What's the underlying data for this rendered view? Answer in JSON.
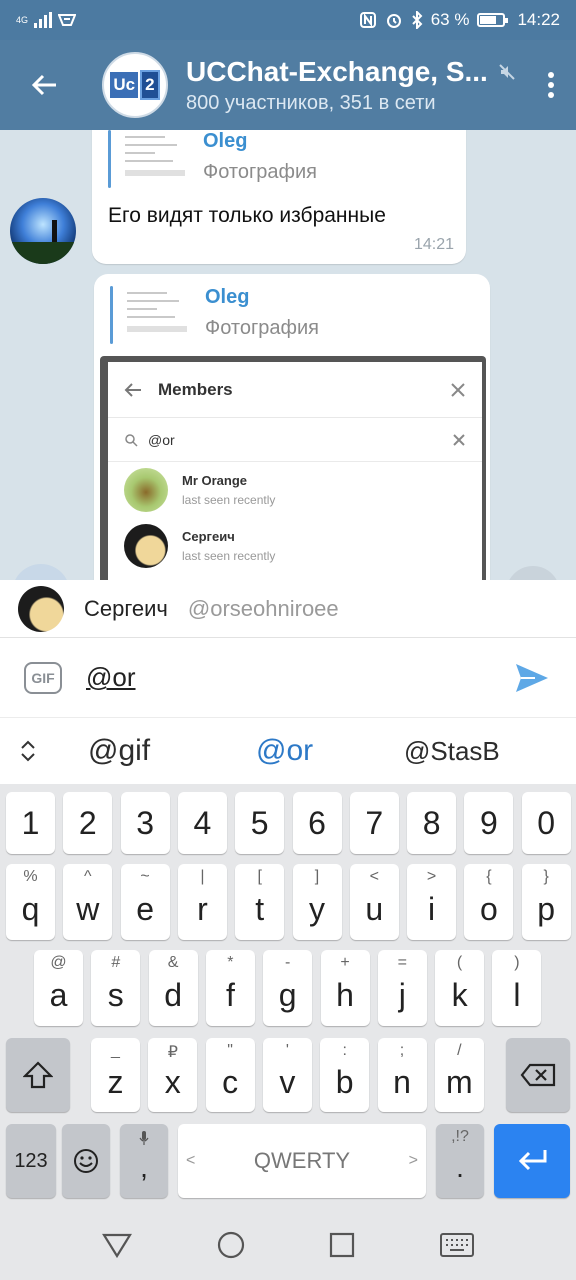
{
  "status_bar": {
    "network": "4G",
    "battery": "63 %",
    "time": "14:22"
  },
  "header": {
    "title": "UCChat-Exchange, S...",
    "subtitle": "800 участников, 351 в сети",
    "avatar_text_a": "Uc",
    "avatar_text_b": "2"
  },
  "messages": [
    {
      "reply_name": "Oleg",
      "reply_sub": "Фотография",
      "text": "Его видят только избранные",
      "time": "14:21"
    },
    {
      "reply_name": "Oleg",
      "reply_sub": "Фотография",
      "members_panel": {
        "title": "Members",
        "search": "@or",
        "rows": [
          {
            "name": "Mr Orange",
            "seen": "last seen recently"
          },
          {
            "name": "Сергеич",
            "seen": "last seen recently"
          }
        ]
      }
    }
  ],
  "mention": {
    "name": "Сергеич",
    "handle": "@orseohniroee"
  },
  "composer": {
    "gif_label": "GIF",
    "value": "@or"
  },
  "suggestions": [
    "@gif",
    "@or",
    "@StasB"
  ],
  "keyboard": {
    "row_numbers": [
      "1",
      "2",
      "3",
      "4",
      "5",
      "6",
      "7",
      "8",
      "9",
      "0"
    ],
    "row1": [
      [
        "q",
        "%"
      ],
      [
        "w",
        "^"
      ],
      [
        "e",
        "~"
      ],
      [
        "r",
        "|"
      ],
      [
        "t",
        "["
      ],
      [
        "y",
        "]"
      ],
      [
        "u",
        "<"
      ],
      [
        "i",
        ">"
      ],
      [
        "o",
        "{"
      ],
      [
        "p",
        "}"
      ]
    ],
    "row2": [
      [
        "a",
        "@"
      ],
      [
        "s",
        "#"
      ],
      [
        "d",
        "&"
      ],
      [
        "f",
        "*"
      ],
      [
        "g",
        "-"
      ],
      [
        "h",
        "+"
      ],
      [
        "j",
        "="
      ],
      [
        "k",
        "("
      ],
      [
        "l",
        ")"
      ]
    ],
    "row3": [
      [
        "z",
        "_"
      ],
      [
        "x",
        "₽"
      ],
      [
        "c",
        "\""
      ],
      [
        "v",
        "'"
      ],
      [
        "b",
        ":"
      ],
      [
        "n",
        ";"
      ],
      [
        "m",
        "/"
      ]
    ],
    "key_123": "123",
    "key_comma": ",",
    "space_label": "QWERTY",
    "space_left": "<",
    "space_right": ">",
    "key_period": ".",
    "key_period_sec": ",!?"
  },
  "colors": {
    "header": "#517da2",
    "accent": "#2d79c7",
    "send": "#5ea8e6"
  }
}
